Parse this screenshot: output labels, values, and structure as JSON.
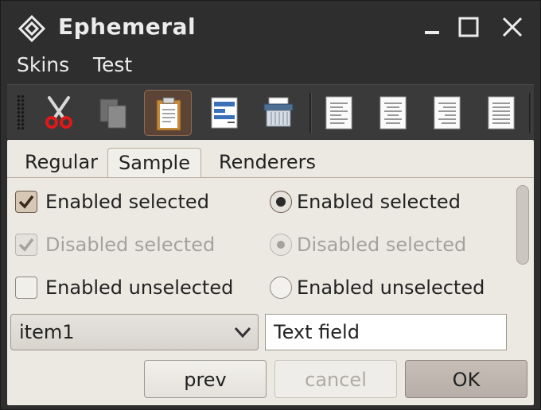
{
  "window": {
    "title": "Ephemeral"
  },
  "menu": {
    "items": [
      "Skins",
      "Test"
    ]
  },
  "toolbar": {
    "buttons": [
      {
        "name": "cut",
        "icon": "scissors-icon"
      },
      {
        "name": "copy",
        "icon": "copy-icon"
      },
      {
        "name": "paste",
        "icon": "clipboard-icon",
        "active": true
      },
      {
        "name": "document",
        "icon": "document-icon"
      },
      {
        "name": "shred",
        "icon": "shredder-icon"
      },
      {
        "name": "align-left",
        "icon": "align-left-icon"
      },
      {
        "name": "align-center",
        "icon": "align-center-icon"
      },
      {
        "name": "align-right",
        "icon": "align-right-icon"
      },
      {
        "name": "justify",
        "icon": "justify-icon"
      }
    ]
  },
  "tabs": {
    "items": [
      "Regular",
      "Sample",
      "Renderers"
    ],
    "selected": "Sample"
  },
  "sample": {
    "checkboxes": [
      {
        "label": "Enabled selected",
        "checked": true,
        "enabled": true
      },
      {
        "label": "Disabled selected",
        "checked": true,
        "enabled": false
      },
      {
        "label": "Enabled unselected",
        "checked": false,
        "enabled": true
      }
    ],
    "radios": [
      {
        "label": "Enabled selected",
        "selected": true,
        "enabled": true
      },
      {
        "label": "Disabled selected",
        "selected": true,
        "enabled": false
      },
      {
        "label": "Enabled unselected",
        "selected": false,
        "enabled": true
      }
    ],
    "combo_value": "item1",
    "text_field_value": "Text field"
  },
  "buttons": {
    "prev": "prev",
    "cancel": "cancel",
    "ok": "OK"
  },
  "colors": {
    "chrome": "#2e2e2e",
    "panel": "#ece9e3",
    "accent": "#7a4f2e"
  }
}
